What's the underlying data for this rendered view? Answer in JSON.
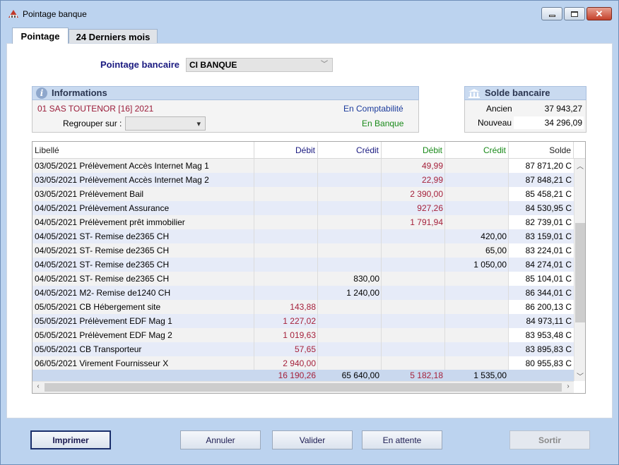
{
  "window": {
    "title": "Pointage banque",
    "close_glyph": "✕"
  },
  "tabs": [
    {
      "label": "Pointage",
      "active": true
    },
    {
      "label": "24 Derniers mois",
      "active": false
    }
  ],
  "pointage": {
    "label": "Pointage bancaire",
    "value": "CI BANQUE"
  },
  "informations": {
    "title": "Informations",
    "company": "01 SAS TOUTENOR [16] 2021",
    "en_compta": "En Comptabilité",
    "en_banque": "En Banque",
    "regroup_label": "Regrouper sur :",
    "regroup_value": ""
  },
  "solde": {
    "title": "Solde bancaire",
    "ancien_label": "Ancien",
    "ancien_value": "37 943,27",
    "nouveau_label": "Nouveau",
    "nouveau_value": "34 296,09"
  },
  "table": {
    "headers": {
      "libelle": "Libellé",
      "debit_compta": "Débit",
      "credit_compta": "Crédit",
      "debit_banque": "Débit",
      "credit_banque": "Crédit",
      "solde": "Solde"
    },
    "rows": [
      {
        "libelle": "03/05/2021 Prélèvement Accès Internet Mag 1",
        "debit_compta": "",
        "credit_compta": "",
        "debit_banque": "49,99",
        "credit_banque": "",
        "solde": "87 871,20 C"
      },
      {
        "libelle": "03/05/2021 Prélèvement Accès Internet Mag 2",
        "debit_compta": "",
        "credit_compta": "",
        "debit_banque": "22,99",
        "credit_banque": "",
        "solde": "87 848,21 C"
      },
      {
        "libelle": "03/05/2021 Prélèvement Bail",
        "debit_compta": "",
        "credit_compta": "",
        "debit_banque": "2 390,00",
        "credit_banque": "",
        "solde": "85 458,21 C"
      },
      {
        "libelle": "04/05/2021 Prélèvement Assurance",
        "debit_compta": "",
        "credit_compta": "",
        "debit_banque": "927,26",
        "credit_banque": "",
        "solde": "84 530,95 C"
      },
      {
        "libelle": "04/05/2021 Prélèvement prêt immobilier",
        "debit_compta": "",
        "credit_compta": "",
        "debit_banque": "1 791,94",
        "credit_banque": "",
        "solde": "82 739,01 C"
      },
      {
        "libelle": "04/05/2021 ST- Remise de2365 CH",
        "debit_compta": "",
        "credit_compta": "",
        "debit_banque": "",
        "credit_banque": "420,00",
        "solde": "83 159,01 C"
      },
      {
        "libelle": "04/05/2021 ST- Remise de2365 CH",
        "debit_compta": "",
        "credit_compta": "",
        "debit_banque": "",
        "credit_banque": "65,00",
        "solde": "83 224,01 C"
      },
      {
        "libelle": "04/05/2021 ST- Remise de2365 CH",
        "debit_compta": "",
        "credit_compta": "",
        "debit_banque": "",
        "credit_banque": "1 050,00",
        "solde": "84 274,01 C"
      },
      {
        "libelle": "04/05/2021 ST- Remise de2365 CH",
        "debit_compta": "",
        "credit_compta": "830,00",
        "debit_banque": "",
        "credit_banque": "",
        "solde": "85 104,01 C"
      },
      {
        "libelle": "04/05/2021 M2- Remise de1240 CH",
        "debit_compta": "",
        "credit_compta": "1 240,00",
        "debit_banque": "",
        "credit_banque": "",
        "solde": "86 344,01 C"
      },
      {
        "libelle": "05/05/2021 CB Hébergement site",
        "debit_compta": "143,88",
        "credit_compta": "",
        "debit_banque": "",
        "credit_banque": "",
        "solde": "86 200,13 C"
      },
      {
        "libelle": "05/05/2021 Prélèvement EDF Mag 1",
        "debit_compta": "1 227,02",
        "credit_compta": "",
        "debit_banque": "",
        "credit_banque": "",
        "solde": "84 973,11 C"
      },
      {
        "libelle": "05/05/2021 Prélèvement EDF Mag 2",
        "debit_compta": "1 019,63",
        "credit_compta": "",
        "debit_banque": "",
        "credit_banque": "",
        "solde": "83 953,48 C"
      },
      {
        "libelle": "05/05/2021 CB Transporteur",
        "debit_compta": "57,65",
        "credit_compta": "",
        "debit_banque": "",
        "credit_banque": "",
        "solde": "83 895,83 C"
      },
      {
        "libelle": "06/05/2021 Virement Fournisseur X",
        "debit_compta": "2 940,00",
        "credit_compta": "",
        "debit_banque": "",
        "credit_banque": "",
        "solde": "80 955,83 C"
      }
    ],
    "totals": {
      "debit_compta": "16 190,26",
      "credit_compta": "65 640,00",
      "debit_banque": "5 182,18",
      "credit_banque": "1 535,00"
    }
  },
  "buttons": {
    "imprimer": "Imprimer",
    "annuler": "Annuler",
    "valider": "Valider",
    "en_attente": "En attente",
    "sortir": "Sortir"
  },
  "colors": {
    "compta_header": "#1a1a80",
    "banque_header": "#1a8a1a",
    "amount_red": "#a5213b",
    "row_alt": "#e6ebf8"
  },
  "icons": [
    "app-icon",
    "info-icon",
    "bank-icon",
    "chevron-down-icon",
    "scroll-up-icon",
    "scroll-down-icon",
    "scroll-left-icon",
    "scroll-right-icon"
  ]
}
